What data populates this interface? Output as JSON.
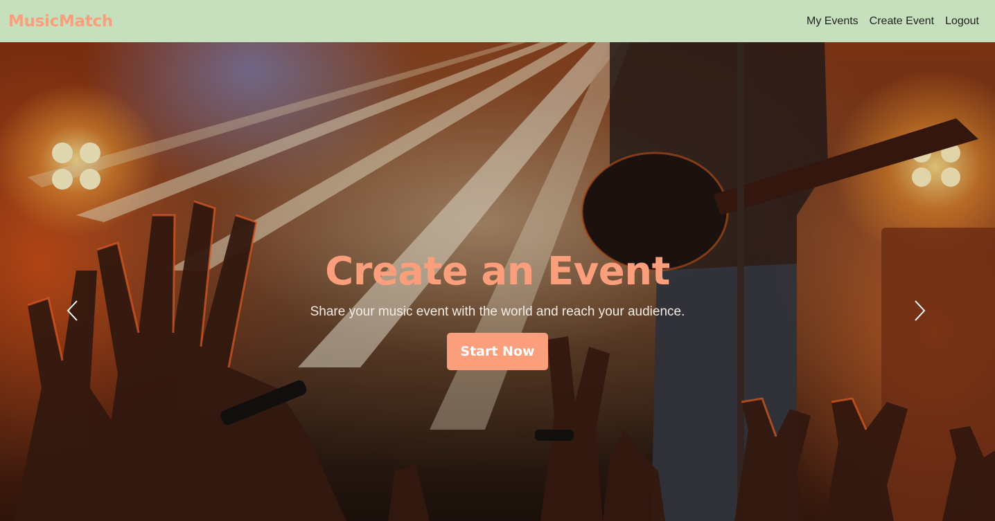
{
  "navbar": {
    "brand": "MusicMatch",
    "links": [
      {
        "label": "My Events"
      },
      {
        "label": "Create Event"
      },
      {
        "label": "Logout"
      }
    ]
  },
  "hero": {
    "title": "Create an Event",
    "subtitle": "Share your music event with the world and reach your audience.",
    "cta_label": "Start Now",
    "prev_icon": "chevron-left-icon",
    "next_icon": "chevron-right-icon"
  },
  "colors": {
    "navbar_bg": "#c6e0bd",
    "accent": "#fb9e7b",
    "nav_text": "#222222",
    "subtitle_text": "#f4ece4"
  }
}
